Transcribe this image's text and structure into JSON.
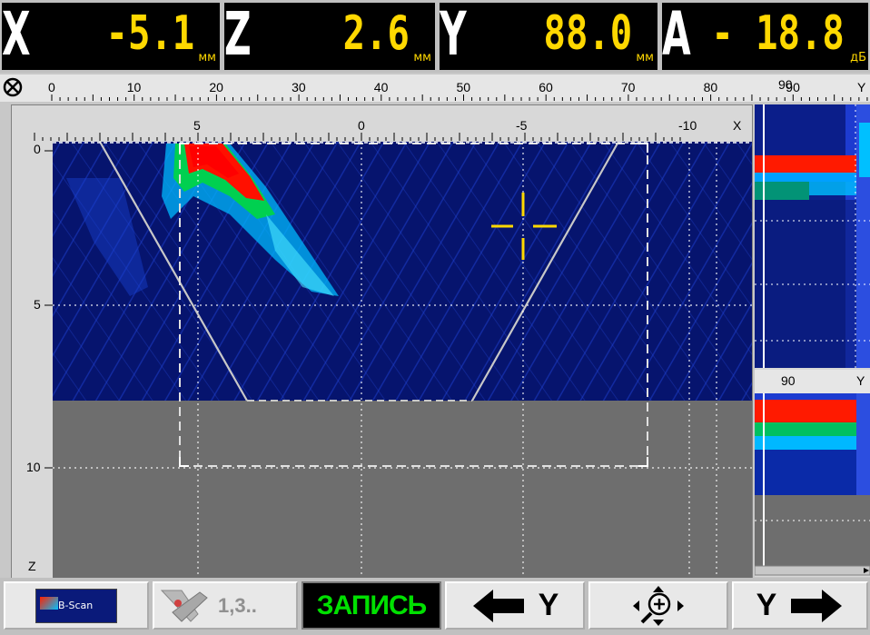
{
  "readouts": [
    {
      "axis": "X",
      "value": "-5.1",
      "unit": "мм"
    },
    {
      "axis": "Z",
      "value": "2.6",
      "unit": "мм"
    },
    {
      "axis": "Y",
      "value": "88.0",
      "unit": "мм"
    },
    {
      "axis": "A",
      "value": "- 18.8",
      "unit": "дБ"
    }
  ],
  "top_axis": {
    "ticks": [
      "0",
      "10",
      "20",
      "30",
      "40",
      "50",
      "60",
      "70",
      "80",
      "90"
    ],
    "end_label": "Y"
  },
  "bscan": {
    "x_ticks": [
      "5",
      "0",
      "-5",
      "-10"
    ],
    "x_label": "X",
    "z_ticks": [
      "0",
      "5",
      "10"
    ],
    "z_label": "Z"
  },
  "side_top": {
    "label": "90",
    "end_label": "Y"
  },
  "side_bottom": {
    "label": "90",
    "end_label": "Y"
  },
  "toolbar": {
    "bscan_label": "B-Scan",
    "files_label": "1,3..",
    "record_label": "ЗАПИСЬ",
    "left_y_label": "Y",
    "right_y_label": "Y"
  },
  "colors": {
    "readout_value": "#ffd800",
    "record_text": "#00e000",
    "scan_background": "#06146e",
    "gray_zone": "#6e6e6e",
    "cursor": "#ffd800"
  },
  "icons": [
    "scan-direction-icon",
    "bscan-thumbnail-icon",
    "tools-icon",
    "arrow-left-icon",
    "zoom-icon",
    "arrow-right-icon"
  ]
}
